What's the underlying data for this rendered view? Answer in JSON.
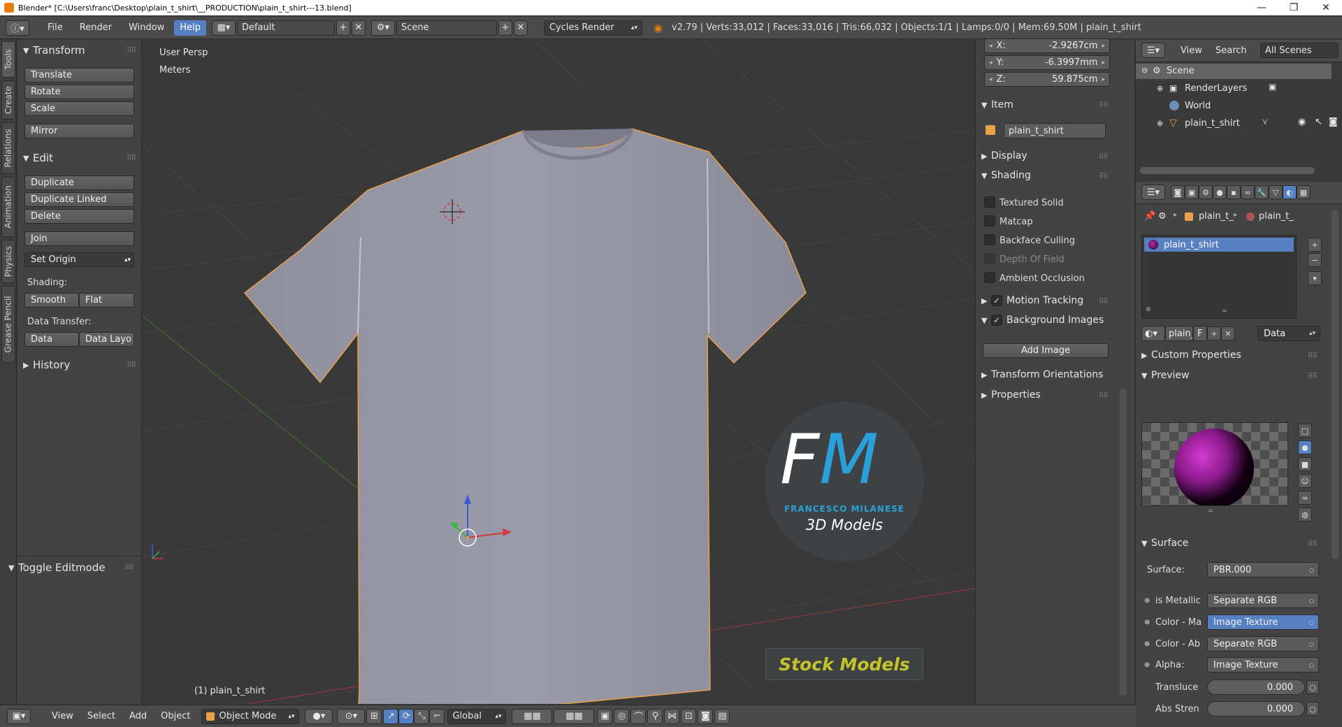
{
  "window": {
    "title": "Blender* [C:\\Users\\franc\\Desktop\\plain_t_shirt\\__PRODUCTION\\plain_t_shirt---13.blend]",
    "minimize": "—",
    "maximize": "❐",
    "close": "✕"
  },
  "infobar": {
    "menus": [
      "File",
      "Render",
      "Window",
      "Help"
    ],
    "layout": "Default",
    "scene": "Scene",
    "engine": "Cycles Render",
    "stats": "v2.79 | Verts:33,012 | Faces:33,016 | Tris:66,032 | Objects:1/1 | Lamps:0/0 | Mem:69.50M | plain_t_shirt"
  },
  "tabs": [
    "Tools",
    "Create",
    "Relations",
    "Animation",
    "Physics",
    "Grease Pencil"
  ],
  "toolshelf": {
    "transform_header": "Transform",
    "translate": "Translate",
    "rotate": "Rotate",
    "scale": "Scale",
    "mirror": "Mirror",
    "edit_header": "Edit",
    "duplicate": "Duplicate",
    "duplicate_linked": "Duplicate Linked",
    "delete": "Delete",
    "join": "Join",
    "set_origin": "Set Origin",
    "shading_label": "Shading:",
    "smooth": "Smooth",
    "flat": "Flat",
    "data_transfer_label": "Data Transfer:",
    "data": "Data",
    "data_layo": "Data Layo",
    "history": "History",
    "toggle_editmode": "Toggle Editmode"
  },
  "viewport": {
    "view_name": "User Persp",
    "units": "Meters",
    "object_label": "(1) plain_t_shirt",
    "logo_letters": "FM",
    "logo_name": "FRANCESCO MILANESE",
    "logo_tag": "3D Models",
    "stock": "Stock Models"
  },
  "npanel": {
    "x_label": "X:",
    "x_value": "-2.9267cm",
    "y_label": "Y:",
    "y_value": "-6.3997mm",
    "z_label": "Z:",
    "z_value": "59.875cm",
    "item_header": "Item",
    "item_name": "plain_t_shirt",
    "display_header": "Display",
    "shading_header": "Shading",
    "textured_solid": "Textured Solid",
    "matcap": "Matcap",
    "backface_culling": "Backface Culling",
    "depth_of_field": "Depth Of Field",
    "ambient_occlusion": "Ambient Occlusion",
    "motion_tracking": "Motion Tracking",
    "background_images": "Background Images",
    "add_image": "Add Image",
    "transform_orientations": "Transform Orientations",
    "properties": "Properties"
  },
  "outliner": {
    "view": "View",
    "search": "Search",
    "all_scenes": "All Scenes",
    "scene": "Scene",
    "render_layers": "RenderLayers",
    "world": "World",
    "object": "plain_t_shirt"
  },
  "properties": {
    "crumb1": "plain_t_",
    "crumb2": "plain_t_",
    "material": "plain_t_shirt",
    "mat_field": "plain_",
    "mat_f": "F",
    "data_dropdown": "Data",
    "custom_properties": "Custom Properties",
    "preview": "Preview",
    "surface_header": "Surface",
    "surface_label": "Surface:",
    "surface_value": "PBR.000",
    "rows": [
      {
        "label": "is Metallic",
        "value": "Separate RGB"
      },
      {
        "label": "Color - Ma",
        "value": "Image Texture"
      },
      {
        "label": "Color - Ab",
        "value": "Separate RGB"
      },
      {
        "label": "Alpha:",
        "value": "Image Texture"
      }
    ],
    "translucence_label": "Translucе",
    "translucence_value": "0.000",
    "abs_label": "Abs Stren",
    "abs_value": "0.000"
  },
  "bottombar": {
    "menus": [
      "View",
      "Select",
      "Add",
      "Object"
    ],
    "mode": "Object Mode",
    "orientation": "Global"
  },
  "colors": {
    "accent": "#5680c2",
    "panel": "#434343",
    "viewport": "#393939",
    "selection_outline": "#e8a04a"
  }
}
